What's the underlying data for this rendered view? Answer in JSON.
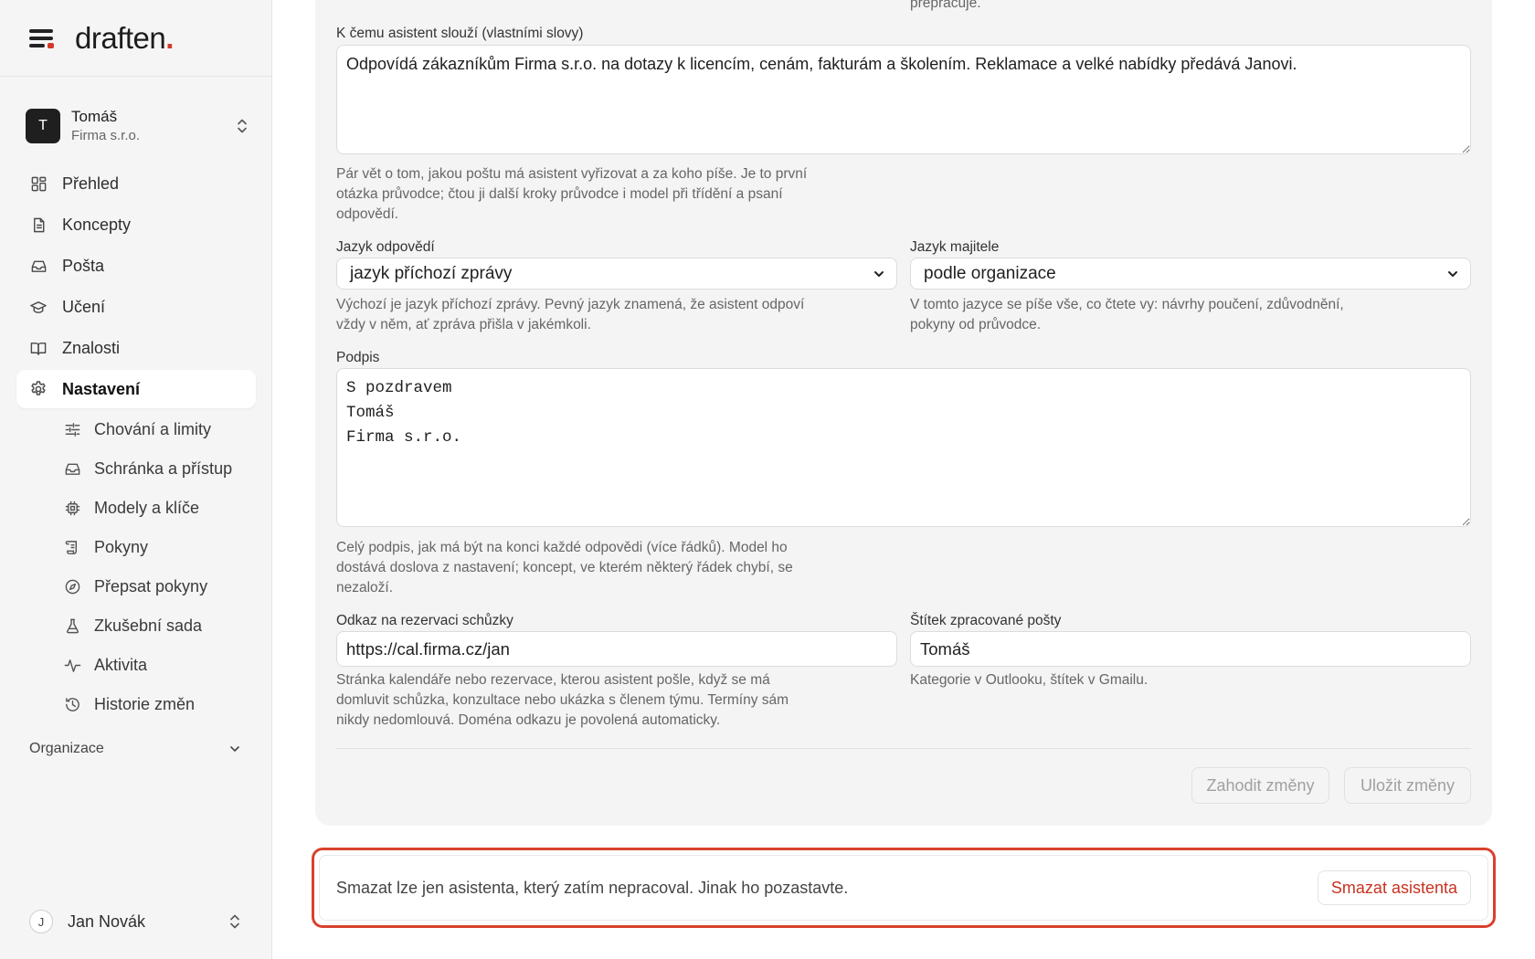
{
  "brand": {
    "name": "draften",
    "dot": "."
  },
  "account": {
    "initial": "T",
    "name": "Tomáš",
    "org": "Firma s.r.o."
  },
  "nav": [
    {
      "label": "Přehled",
      "icon": "dashboard-icon"
    },
    {
      "label": "Koncepty",
      "icon": "document-icon"
    },
    {
      "label": "Pošta",
      "icon": "inbox-icon"
    },
    {
      "label": "Učení",
      "icon": "graduation-cap-icon"
    },
    {
      "label": "Znalosti",
      "icon": "book-icon"
    },
    {
      "label": "Nastavení",
      "icon": "gear-icon",
      "active": true
    }
  ],
  "subnav": [
    {
      "label": "Chování a limity",
      "icon": "sliders-icon"
    },
    {
      "label": "Schránka a přístup",
      "icon": "inbox-icon"
    },
    {
      "label": "Modely a klíče",
      "icon": "chip-icon"
    },
    {
      "label": "Pokyny",
      "icon": "scroll-icon"
    },
    {
      "label": "Přepsat pokyny",
      "icon": "compass-icon"
    },
    {
      "label": "Zkušební sada",
      "icon": "flask-icon"
    },
    {
      "label": "Aktivita",
      "icon": "activity-icon"
    },
    {
      "label": "Historie změn",
      "icon": "history-icon"
    }
  ],
  "org_section": {
    "label": "Organizace"
  },
  "user": {
    "initial": "J",
    "name": "Jan Novák"
  },
  "form": {
    "top_cut_text": "přepracuje.",
    "purpose": {
      "label": "K čemu asistent slouží (vlastními slovy)",
      "value": "Odpovídá zákazníkům Firma s.r.o. na dotazy k licencím, cenám, fakturám a školením. Reklamace a velké nabídky předává Janovi.",
      "help": "Pár vět o tom, jakou poštu má asistent vyřizovat a za koho píše. Je to první otázka průvodce; čtou ji další kroky průvodce i model při třídění a psaní odpovědí."
    },
    "reply_language": {
      "label": "Jazyk odpovědí",
      "value": "jazyk příchozí zprávy",
      "help": "Výchozí je jazyk příchozí zprávy. Pevný jazyk znamená, že asistent odpoví vždy v něm, ať zpráva přišla v jakémkoli."
    },
    "owner_language": {
      "label": "Jazyk majitele",
      "value": "podle organizace",
      "help": "V tomto jazyce se píše vše, co čtete vy: návrhy poučení, zdůvodnění, pokyny od průvodce."
    },
    "signature": {
      "label": "Podpis",
      "value": "S pozdravem\nTomáš\nFirma s.r.o.",
      "help": "Celý podpis, jak má být na konci každé odpovědi (více řádků). Model ho dostává doslova z nastavení; koncept, ve kterém některý řádek chybí, se nezaloží."
    },
    "booking_link": {
      "label": "Odkaz na rezervaci schůzky",
      "value": "https://cal.firma.cz/jan",
      "help": "Stránka kalendáře nebo rezervace, kterou asistent pošle, když se má domluvit schůzka, konzultace nebo ukázka s členem týmu. Termíny sám nikdy nedomlouvá. Doména odkazu je povolená automaticky."
    },
    "processed_label": {
      "label": "Štítek zpracované pošty",
      "value": "Tomáš",
      "help": "Kategorie v Outlooku, štítek v Gmailu."
    },
    "discard_label": "Zahodit změny",
    "save_label": "Uložit změny"
  },
  "danger": {
    "text": "Smazat lze jen asistenta, který zatím nepracoval. Jinak ho pozastavte.",
    "button": "Smazat asistenta",
    "accent": "#d8412d"
  }
}
